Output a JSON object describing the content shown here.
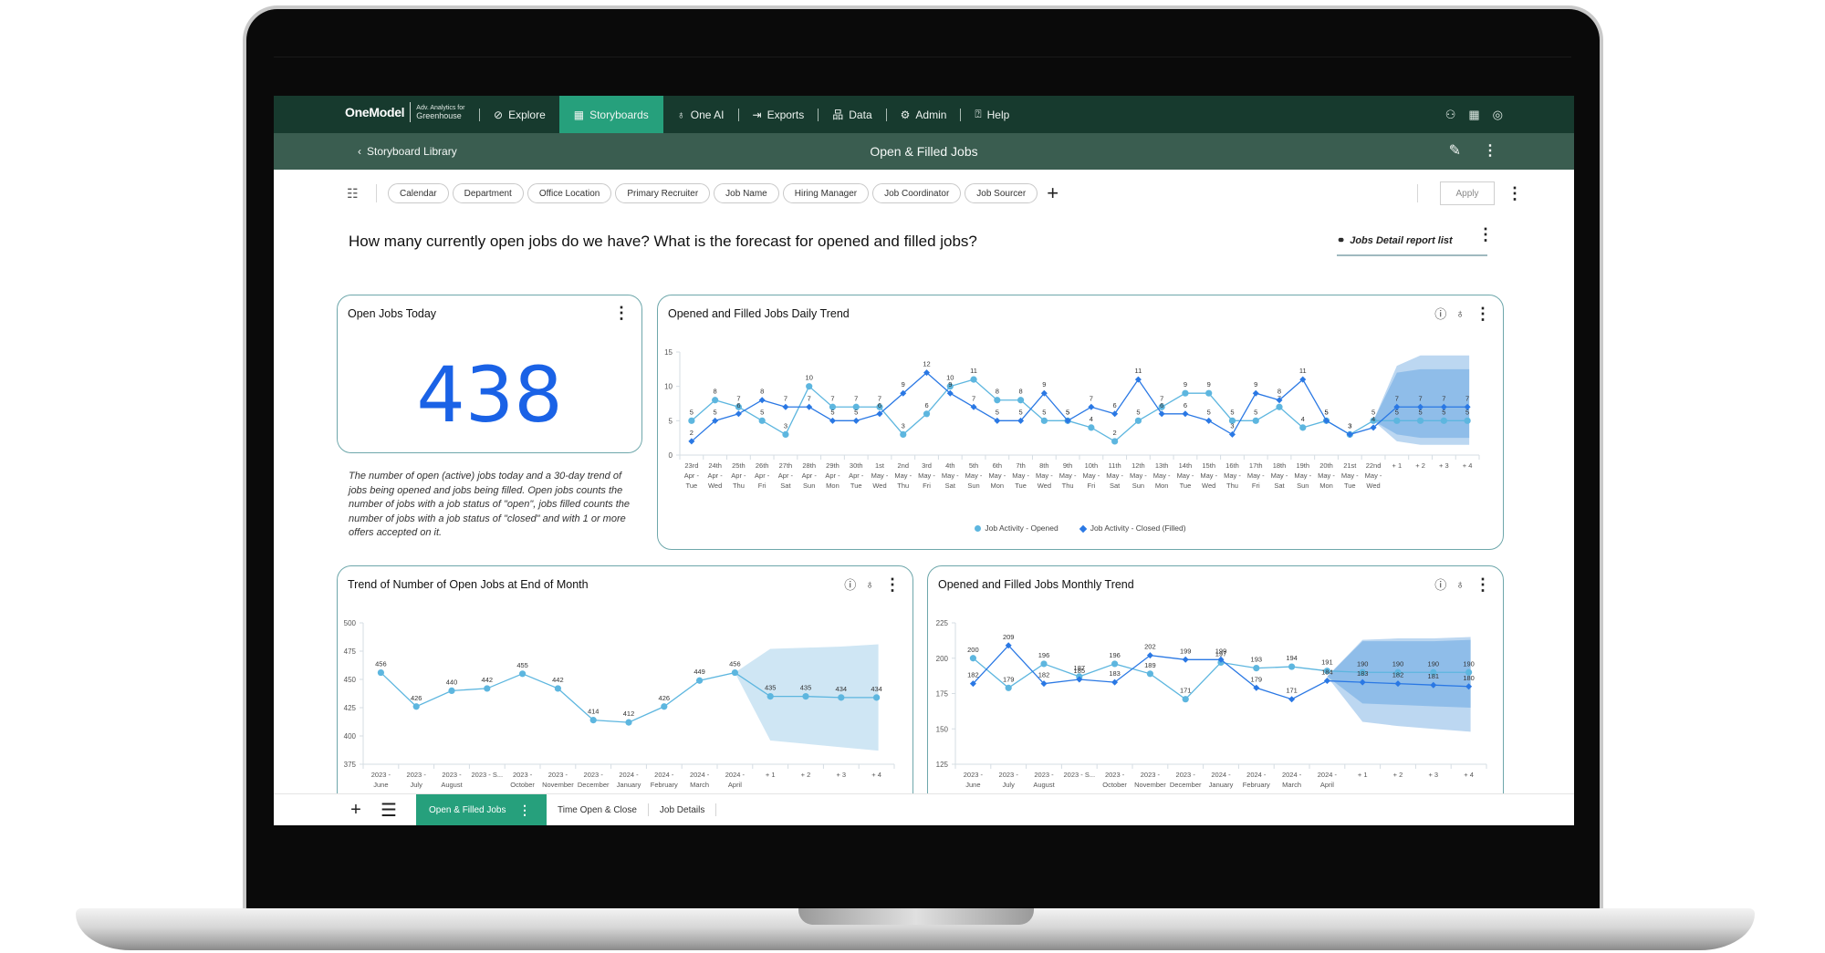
{
  "nav": {
    "logo": "OneModel",
    "logo_sub_small": "Adv. Analytics for",
    "logo_sub": "Greenhouse",
    "items": [
      {
        "label": "Explore",
        "icon": "compass-icon",
        "active": false
      },
      {
        "label": "Storyboards",
        "icon": "storyboard-icon",
        "active": true
      },
      {
        "label": "One AI",
        "icon": "lightbulb-icon",
        "active": false
      },
      {
        "label": "Exports",
        "icon": "export-icon",
        "active": false
      },
      {
        "label": "Data",
        "icon": "hierarchy-icon",
        "active": false
      },
      {
        "label": "Admin",
        "icon": "gear-icon",
        "active": false
      },
      {
        "label": "Help",
        "icon": "help-icon",
        "active": false
      }
    ],
    "right_icons": [
      "org-chart-icon",
      "calendar-grid-icon",
      "user-profile-icon"
    ]
  },
  "subbar": {
    "breadcrumb": "Storyboard Library",
    "title": "Open & Filled Jobs"
  },
  "filters": {
    "chips": [
      "Calendar",
      "Department",
      "Office Location",
      "Primary Recruiter",
      "Job Name",
      "Hiring Manager",
      "Job Coordinator",
      "Job Sourcer"
    ],
    "apply_label": "Apply"
  },
  "question": "How many currently open jobs do we have?  What is the forecast for opened and filled jobs?",
  "report_link": "Jobs Detail report list",
  "kpi_card": {
    "title": "Open Jobs Today",
    "value": "438",
    "description": "The number of open (active) jobs today and a 30-day trend of jobs being opened and jobs being filled.  Open jobs counts the number of jobs with a job status of \"open\", jobs filled counts the number of jobs with a job status of \"closed\" and with 1 or more offers accepted on it."
  },
  "colors": {
    "nav_bg": "#173a2e",
    "subbar_bg": "#3a5d50",
    "accent": "#26a07c",
    "kpi": "#1a62e6",
    "opened": "#5db6df",
    "closed": "#2a78e4",
    "forecast_band": "#9cc7ec"
  },
  "chart_data": [
    {
      "id": "daily",
      "type": "line",
      "title": "Opened and Filled Jobs Daily Trend",
      "ylim": [
        0,
        15
      ],
      "yticks": [
        0,
        5,
        10,
        15
      ],
      "categories": [
        [
          "23rd",
          "Apr -",
          "Tue"
        ],
        [
          "24th",
          "Apr -",
          "Wed"
        ],
        [
          "25th",
          "Apr -",
          "Thu"
        ],
        [
          "26th",
          "Apr -",
          "Fri"
        ],
        [
          "27th",
          "Apr -",
          "Sat"
        ],
        [
          "28th",
          "Apr -",
          "Sun"
        ],
        [
          "29th",
          "Apr -",
          "Mon"
        ],
        [
          "30th",
          "Apr -",
          "Tue"
        ],
        [
          "1st",
          "May -",
          "Wed"
        ],
        [
          "2nd",
          "May -",
          "Thu"
        ],
        [
          "3rd",
          "May -",
          "Fri"
        ],
        [
          "4th",
          "May -",
          "Sat"
        ],
        [
          "5th",
          "May -",
          "Sun"
        ],
        [
          "6th",
          "May -",
          "Mon"
        ],
        [
          "7th",
          "May -",
          "Tue"
        ],
        [
          "8th",
          "May -",
          "Wed"
        ],
        [
          "9th",
          "May -",
          "Thu"
        ],
        [
          "10th",
          "May -",
          "Fri"
        ],
        [
          "11th",
          "May -",
          "Sat"
        ],
        [
          "12th",
          "May -",
          "Sun"
        ],
        [
          "13th",
          "May -",
          "Mon"
        ],
        [
          "14th",
          "May -",
          "Tue"
        ],
        [
          "15th",
          "May -",
          "Wed"
        ],
        [
          "16th",
          "May -",
          "Thu"
        ],
        [
          "17th",
          "May -",
          "Fri"
        ],
        [
          "18th",
          "May -",
          "Sat"
        ],
        [
          "19th",
          "May -",
          "Sun"
        ],
        [
          "20th",
          "May -",
          "Mon"
        ],
        [
          "21st",
          "May -",
          "Tue"
        ],
        [
          "22nd",
          "May -",
          "Wed"
        ],
        [
          "+ 1"
        ],
        [
          "+ 2"
        ],
        [
          "+ 3"
        ],
        [
          "+ 4"
        ]
      ],
      "forecast_start": 30,
      "series": [
        {
          "name": "Job Activity - Opened",
          "marker": "circle",
          "values": [
            5,
            8,
            7,
            5,
            3,
            10,
            7,
            7,
            7,
            3,
            6,
            10,
            11,
            8,
            8,
            5,
            5,
            4,
            2,
            5,
            7,
            9,
            9,
            5,
            5,
            7,
            4,
            5,
            3,
            5,
            5,
            5,
            5,
            5
          ]
        },
        {
          "name": "Job Activity - Closed (Filled)",
          "marker": "diamond",
          "values": [
            2,
            5,
            6,
            8,
            7,
            7,
            5,
            5,
            6,
            9,
            12,
            9,
            7,
            5,
            5,
            9,
            5,
            7,
            6,
            11,
            6,
            6,
            5,
            3,
            9,
            8,
            11,
            5,
            3,
            4,
            7,
            7,
            7,
            7
          ]
        }
      ],
      "forecast_band_outer": [
        [
          5,
          5
        ],
        [
          2,
          13
        ],
        [
          1.5,
          14.5
        ],
        [
          1.5,
          14.5
        ],
        [
          1.5,
          14.5
        ]
      ],
      "forecast_band_inner": [
        [
          5,
          5
        ],
        [
          3,
          12
        ],
        [
          2.5,
          12.5
        ],
        [
          2.5,
          12.5
        ],
        [
          2.5,
          12.5
        ]
      ],
      "legend": [
        "Job Activity - Opened",
        "Job Activity - Closed (Filled)"
      ],
      "legend_position": "bottom"
    },
    {
      "id": "eom",
      "type": "line",
      "title": "Trend of Number of Open Jobs at End of Month",
      "ylim": [
        375,
        500
      ],
      "yticks": [
        375,
        400,
        425,
        450,
        475,
        500
      ],
      "categories": [
        [
          "2023 -",
          "June"
        ],
        [
          "2023 -",
          "July"
        ],
        [
          "2023 -",
          "August"
        ],
        [
          "2023 - S..."
        ],
        [
          "2023 -",
          "October"
        ],
        [
          "2023 -",
          "November"
        ],
        [
          "2023 -",
          "December"
        ],
        [
          "2024 -",
          "January"
        ],
        [
          "2024 -",
          "February"
        ],
        [
          "2024 -",
          "March"
        ],
        [
          "2024 -",
          "April"
        ],
        [
          "+ 1"
        ],
        [
          "+ 2"
        ],
        [
          "+ 3"
        ],
        [
          "+ 4"
        ]
      ],
      "forecast_start": 11,
      "series": [
        {
          "name": "Open Jobs",
          "marker": "circle",
          "values": [
            456,
            426,
            440,
            442,
            455,
            442,
            414,
            412,
            426,
            449,
            456,
            435,
            435,
            434,
            434
          ]
        }
      ],
      "forecast_band_outer": [
        [
          456,
          456
        ],
        [
          396,
          477
        ],
        [
          393,
          478
        ],
        [
          390,
          479
        ],
        [
          387,
          481
        ]
      ]
    },
    {
      "id": "monthly",
      "type": "line",
      "title": "Opened and Filled Jobs Monthly Trend",
      "ylim": [
        125,
        225
      ],
      "yticks": [
        125,
        150,
        175,
        200,
        225
      ],
      "categories": [
        [
          "2023 -",
          "June"
        ],
        [
          "2023 -",
          "July"
        ],
        [
          "2023 -",
          "August"
        ],
        [
          "2023 - S..."
        ],
        [
          "2023 -",
          "October"
        ],
        [
          "2023 -",
          "November"
        ],
        [
          "2023 -",
          "December"
        ],
        [
          "2024 -",
          "January"
        ],
        [
          "2024 -",
          "February"
        ],
        [
          "2024 -",
          "March"
        ],
        [
          "2024 -",
          "April"
        ],
        [
          "+ 1"
        ],
        [
          "+ 2"
        ],
        [
          "+ 3"
        ],
        [
          "+ 4"
        ]
      ],
      "forecast_start": 11,
      "series": [
        {
          "name": "Job Activity - Opened",
          "marker": "circle",
          "values": [
            200,
            179,
            196,
            187,
            196,
            189,
            171,
            197,
            193,
            194,
            191,
            190,
            190,
            190,
            190
          ]
        },
        {
          "name": "Job Activity - Closed (Filled)",
          "marker": "diamond",
          "values": [
            182,
            209,
            182,
            185,
            183,
            202,
            199,
            199,
            179,
            171,
            184,
            183,
            182,
            181,
            180
          ]
        }
      ],
      "forecast_band_outer": [
        [
          187,
          187
        ],
        [
          155,
          213
        ],
        [
          152,
          214
        ],
        [
          150,
          214
        ],
        [
          148,
          215
        ]
      ],
      "forecast_band_inner": [
        [
          187,
          187
        ],
        [
          168,
          212
        ],
        [
          167,
          212
        ],
        [
          166,
          212
        ],
        [
          165,
          213
        ]
      ]
    }
  ],
  "tabs": {
    "items": [
      {
        "label": "Open & Filled Jobs",
        "active": true
      },
      {
        "label": "Time Open & Close",
        "active": false
      },
      {
        "label": "Job Details",
        "active": false
      }
    ]
  }
}
